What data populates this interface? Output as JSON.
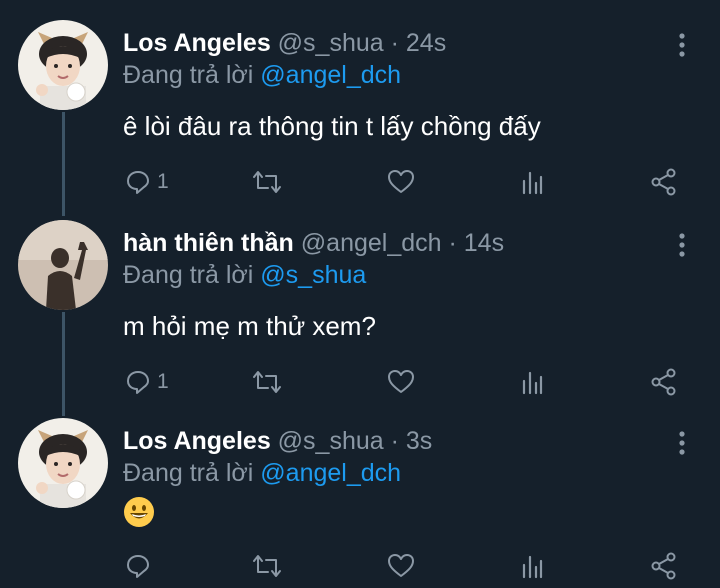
{
  "tweets": [
    {
      "display_name": "Los Angeles",
      "handle": "@s_shua",
      "separator": "·",
      "time": "24s",
      "reply_prefix": "Đang trả lời",
      "reply_to": "@angel_dch",
      "text": "ê lòi đâu ra thông tin t lấy chồng đấy",
      "reply_count": "1"
    },
    {
      "display_name": "hàn thiên thần",
      "handle": "@angel_dch",
      "separator": "·",
      "time": "14s",
      "reply_prefix": "Đang trả lời",
      "reply_to": "@s_shua",
      "text": "m hỏi mẹ m thử xem?",
      "reply_count": "1"
    },
    {
      "display_name": "Los Angeles",
      "handle": "@s_shua",
      "separator": "·",
      "time": "3s",
      "reply_prefix": "Đang trả lời",
      "reply_to": "@angel_dch",
      "emoji": "grinning-face-emoji",
      "reply_count": ""
    }
  ],
  "icons": {
    "reply": "reply-icon",
    "retweet": "retweet-icon",
    "like": "heart-icon",
    "analytics": "analytics-icon",
    "share": "share-icon",
    "more": "more-vertical-icon"
  },
  "colors": {
    "background": "#15202b",
    "secondary_text": "#8b98a5",
    "mention": "#1d9bf0",
    "thread_line": "#3d5466"
  }
}
